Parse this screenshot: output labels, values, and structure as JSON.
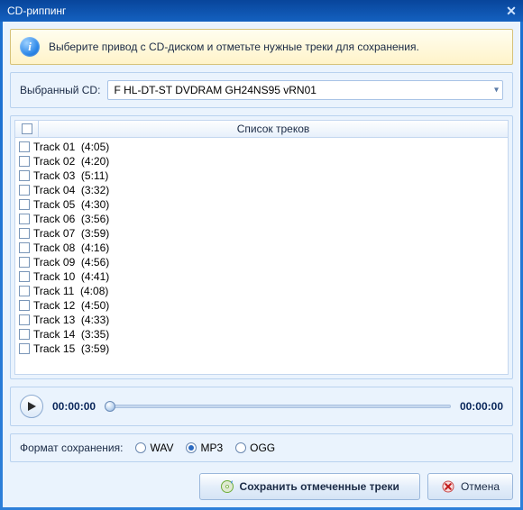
{
  "window": {
    "title": "CD-риппинг"
  },
  "info": {
    "text": "Выберите привод с CD-диском и отметьте нужные треки для сохранения."
  },
  "cd_select": {
    "label": "Выбранный CD:",
    "value": "F HL-DT-ST DVDRAM GH24NS95 vRN01"
  },
  "tracks": {
    "header": "Список треков",
    "items": [
      {
        "name": "Track 01",
        "duration": "4:05"
      },
      {
        "name": "Track 02",
        "duration": "4:20"
      },
      {
        "name": "Track 03",
        "duration": "5:11"
      },
      {
        "name": "Track 04",
        "duration": "3:32"
      },
      {
        "name": "Track 05",
        "duration": "4:30"
      },
      {
        "name": "Track 06",
        "duration": "3:56"
      },
      {
        "name": "Track 07",
        "duration": "3:59"
      },
      {
        "name": "Track 08",
        "duration": "4:16"
      },
      {
        "name": "Track 09",
        "duration": "4:56"
      },
      {
        "name": "Track 10",
        "duration": "4:41"
      },
      {
        "name": "Track 11",
        "duration": "4:08"
      },
      {
        "name": "Track 12",
        "duration": "4:50"
      },
      {
        "name": "Track 13",
        "duration": "4:33"
      },
      {
        "name": "Track 14",
        "duration": "3:35"
      },
      {
        "name": "Track 15",
        "duration": "3:59"
      }
    ]
  },
  "player": {
    "elapsed": "00:00:00",
    "total": "00:00:00"
  },
  "format": {
    "label": "Формат сохранения:",
    "options": [
      {
        "id": "wav",
        "label": "WAV",
        "checked": false
      },
      {
        "id": "mp3",
        "label": "MP3",
        "checked": true
      },
      {
        "id": "ogg",
        "label": "OGG",
        "checked": false
      }
    ]
  },
  "buttons": {
    "save": "Сохранить отмеченные треки",
    "cancel": "Отмена"
  }
}
